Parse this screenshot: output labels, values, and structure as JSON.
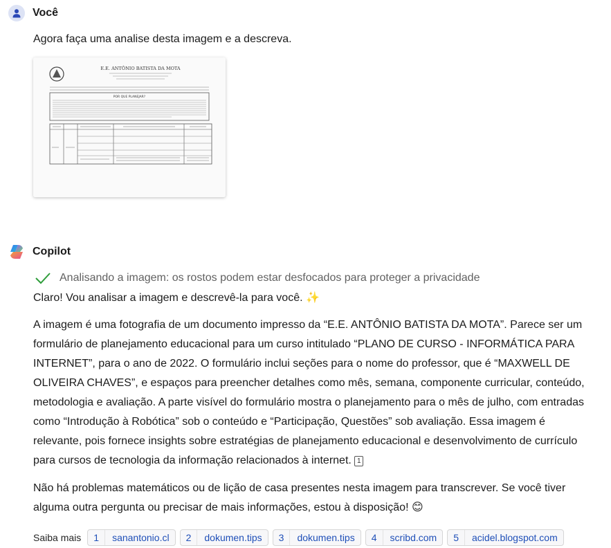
{
  "user_message": {
    "author": "Você",
    "avatar_icon": "person-icon",
    "text": "Agora faça uma analise desta imagem e a descreva.",
    "attachment": {
      "school_name": "E.E. ANTÔNIO BATISTA DA MOTA",
      "box_title": "POR QUE PLANEJAR?"
    }
  },
  "copilot_message": {
    "author": "Copilot",
    "avatar_icon": "copilot-logo-icon",
    "status": "Analisando a imagem: os rostos podem estar desfocados para proteger a privacidade",
    "intro": "Claro! Vou analisar a imagem e descrevê-la para você. ✨",
    "paragraph1": "A imagem é uma fotografia de um documento impresso da “E.E. ANTÔNIO BATISTA DA MOTA”. Parece ser um formulário de planejamento educacional para um curso intitulado “PLANO DE CURSO - INFORMÁTICA PARA INTERNET”, para o ano de 2022. O formulário inclui seções para o nome do professor, que é “MAXWELL DE OLIVEIRA CHAVES”, e espaços para preencher detalhes como mês, semana, componente curricular, conteúdo, metodologia e avaliação. A parte visível do formulário mostra o planejamento para o mês de julho, com entradas como “Introdução à Robótica” sob o conteúdo e “Participação, Questões” sob avaliação. Essa imagem é relevante, pois fornece insights sobre estratégias de planejamento educacional e desenvolvimento de currículo para cursos de tecnologia da informação relacionados à internet.",
    "paragraph1_ref": "1",
    "paragraph2": "Não há problemas matemáticos ou de lição de casa presentes nesta imagem para transcrever. Se você tiver alguma outra pergunta ou precisar de mais informações, estou à disposição! 😊",
    "learn_more_label": "Saiba mais",
    "sources": [
      {
        "num": "1",
        "label": "sanantonio.cl"
      },
      {
        "num": "2",
        "label": "dokumen.tips"
      },
      {
        "num": "3",
        "label": "dokumen.tips"
      },
      {
        "num": "4",
        "label": "scribd.com"
      },
      {
        "num": "5",
        "label": "acidel.blogspot.com"
      }
    ]
  },
  "colors": {
    "accent_green": "#2e9d3a",
    "link_blue": "#1f4fb8",
    "user_avatar_bg": "#dde3f5",
    "user_avatar_fg": "#2b48b6"
  }
}
